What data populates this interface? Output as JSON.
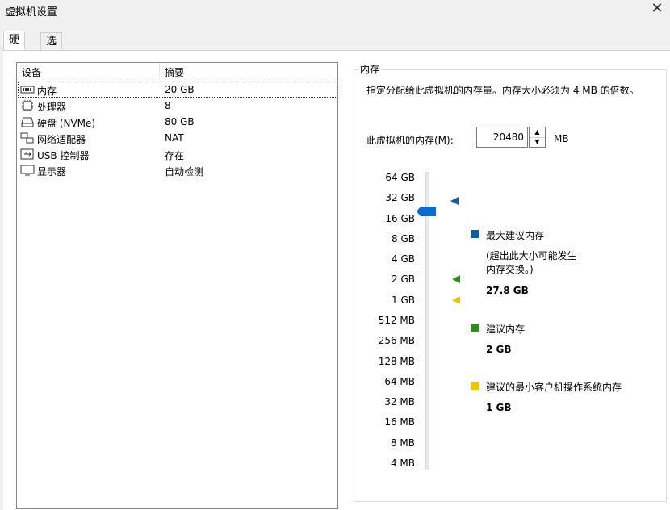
{
  "window": {
    "title": "虚拟机设置",
    "close": "✕"
  },
  "tabs": [
    {
      "label": "硬件"
    },
    {
      "label": "选项"
    }
  ],
  "device_list": {
    "headers": {
      "device": "设备",
      "summary": "摘要"
    },
    "rows": [
      {
        "name": "内存",
        "summary": "20 GB",
        "icon": "memory-icon"
      },
      {
        "name": "处理器",
        "summary": "8",
        "icon": "processor-icon"
      },
      {
        "name": "硬盘 (NVMe)",
        "summary": "80 GB",
        "icon": "hard-disk-icon"
      },
      {
        "name": "网络适配器",
        "summary": "NAT",
        "icon": "network-adapter-icon"
      },
      {
        "name": "USB 控制器",
        "summary": "存在",
        "icon": "usb-icon"
      },
      {
        "name": "显示器",
        "summary": "自动检测",
        "icon": "display-icon"
      }
    ]
  },
  "memory": {
    "group_title": "内存",
    "description": "指定分配给此虚拟机的内存量。内存大小必须为 4 MB 的倍数。",
    "input_label": "此虚拟机的内存(M):",
    "input_value": "20480",
    "unit": "MB",
    "scale": [
      "64 GB",
      "32 GB",
      "16 GB",
      "8 GB",
      "4 GB",
      "2 GB",
      "1 GB",
      "512 MB",
      "256 MB",
      "128 MB",
      "64 MB",
      "32 MB",
      "16 MB",
      "8 MB",
      "4 MB"
    ],
    "legend": {
      "max": {
        "label": "最大建议内存",
        "note": "(超出此大小可能发生内存交换。)",
        "value": "27.8 GB",
        "color": "#0f5ea8"
      },
      "recommended": {
        "label": "建议内存",
        "value": "2 GB",
        "color": "#2e8b1f"
      },
      "min": {
        "label": "建议的最小客户机操作系统内存",
        "value": "1 GB",
        "color": "#f2c400"
      }
    },
    "slider_color": "#0b6cd0"
  }
}
